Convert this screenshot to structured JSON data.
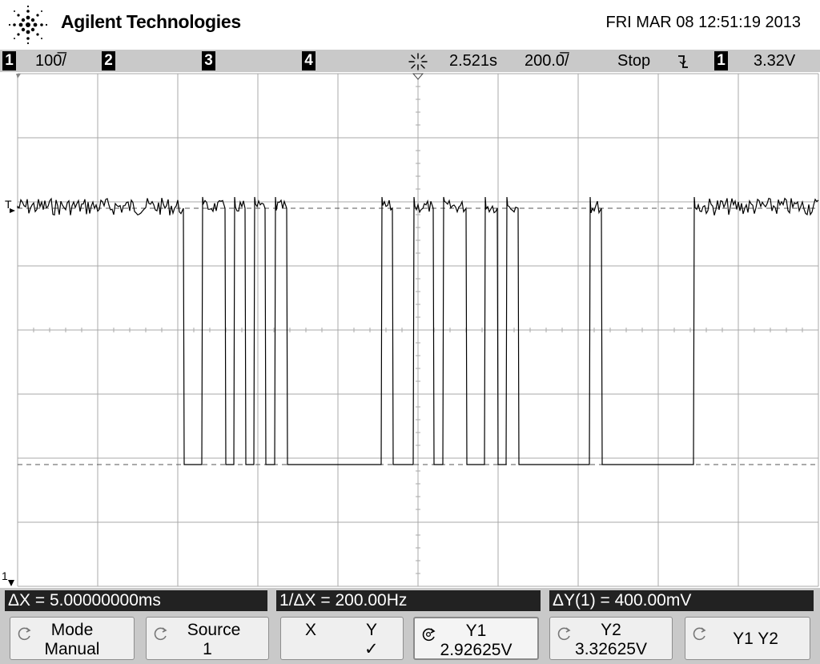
{
  "header": {
    "brand": "Agilent Technologies",
    "datetime": "FRI MAR 08 12:51:19 2013",
    "logo_icon": "agilent-spark-icon"
  },
  "statusbar": {
    "ch1_num": "1",
    "ch1_scale": "100̅/",
    "ch2_num": "2",
    "ch3_num": "3",
    "ch4_num": "4",
    "time_icon": "delay-sparkle-icon",
    "delay": "2.521s",
    "timebase": "200.0̅/",
    "run_state": "Stop",
    "trigger_slope_icon": "falling-edge-icon",
    "trigger_source": "1",
    "trigger_level": "3.32V"
  },
  "screen": {
    "trigger_marker": "T",
    "ground_marker": "1"
  },
  "measurements": {
    "delta_x": "ΔX = 5.00000000ms",
    "inv_delta_x": "1/ΔX = 200.00Hz",
    "delta_y": "ΔY(1) = 400.00mV"
  },
  "softkeys": [
    {
      "line1": "Mode",
      "line2": "Manual",
      "icon": "rotate-knob-icon"
    },
    {
      "line1": "Source",
      "line2": "1",
      "icon": "rotate-knob-icon"
    },
    {
      "line1": "X",
      "line1b": "Y",
      "line2b": "✓"
    },
    {
      "line1": "Y1",
      "line2": "2.92625V",
      "icon": "rotate-knob-active-icon"
    },
    {
      "line1": "Y2",
      "line2": "3.32625V",
      "icon": "rotate-knob-icon"
    },
    {
      "line1": "Y1 Y2",
      "icon": "rotate-knob-icon"
    }
  ],
  "colors": {
    "status_bg": "#c9c9c9",
    "measure_bg": "#222222",
    "trace": "#000000",
    "grid": "#999999"
  }
}
